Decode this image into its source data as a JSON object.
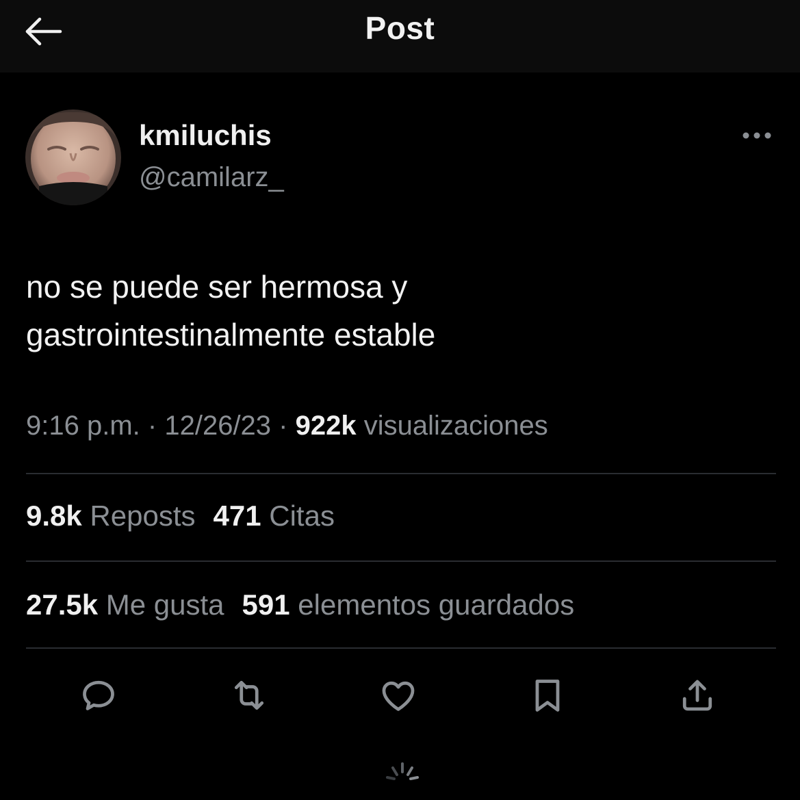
{
  "header": {
    "title": "Post",
    "back_icon": "arrow-left-icon"
  },
  "author": {
    "display_name": "kmiluchis",
    "handle": "@camilarz_",
    "avatar_icon": "profile-photo"
  },
  "post": {
    "text_lines": [
      "no se puede ser hermosa y",
      "gastrointestinalmente estable"
    ]
  },
  "meta": {
    "time": "9:16 p.m.",
    "separator": "·",
    "date": "12/26/23",
    "views_count": "922k",
    "views_label": "visualizaciones"
  },
  "stats": {
    "reposts_count": "9.8k",
    "reposts_label": "Reposts",
    "quotes_count": "471",
    "quotes_label": "Citas",
    "likes_count": "27.5k",
    "likes_label": "Me gusta",
    "bookmarks_count": "591",
    "bookmarks_label": "elementos guardados"
  },
  "actions": {
    "icons": [
      "reply-icon",
      "repost-icon",
      "like-icon",
      "bookmark-icon",
      "share-icon"
    ]
  },
  "colors": {
    "background": "#000000",
    "header_background": "#0c0c0c",
    "text_primary": "#f0f0f0",
    "text_secondary": "#8b8f94",
    "divider": "#2a2d31"
  }
}
